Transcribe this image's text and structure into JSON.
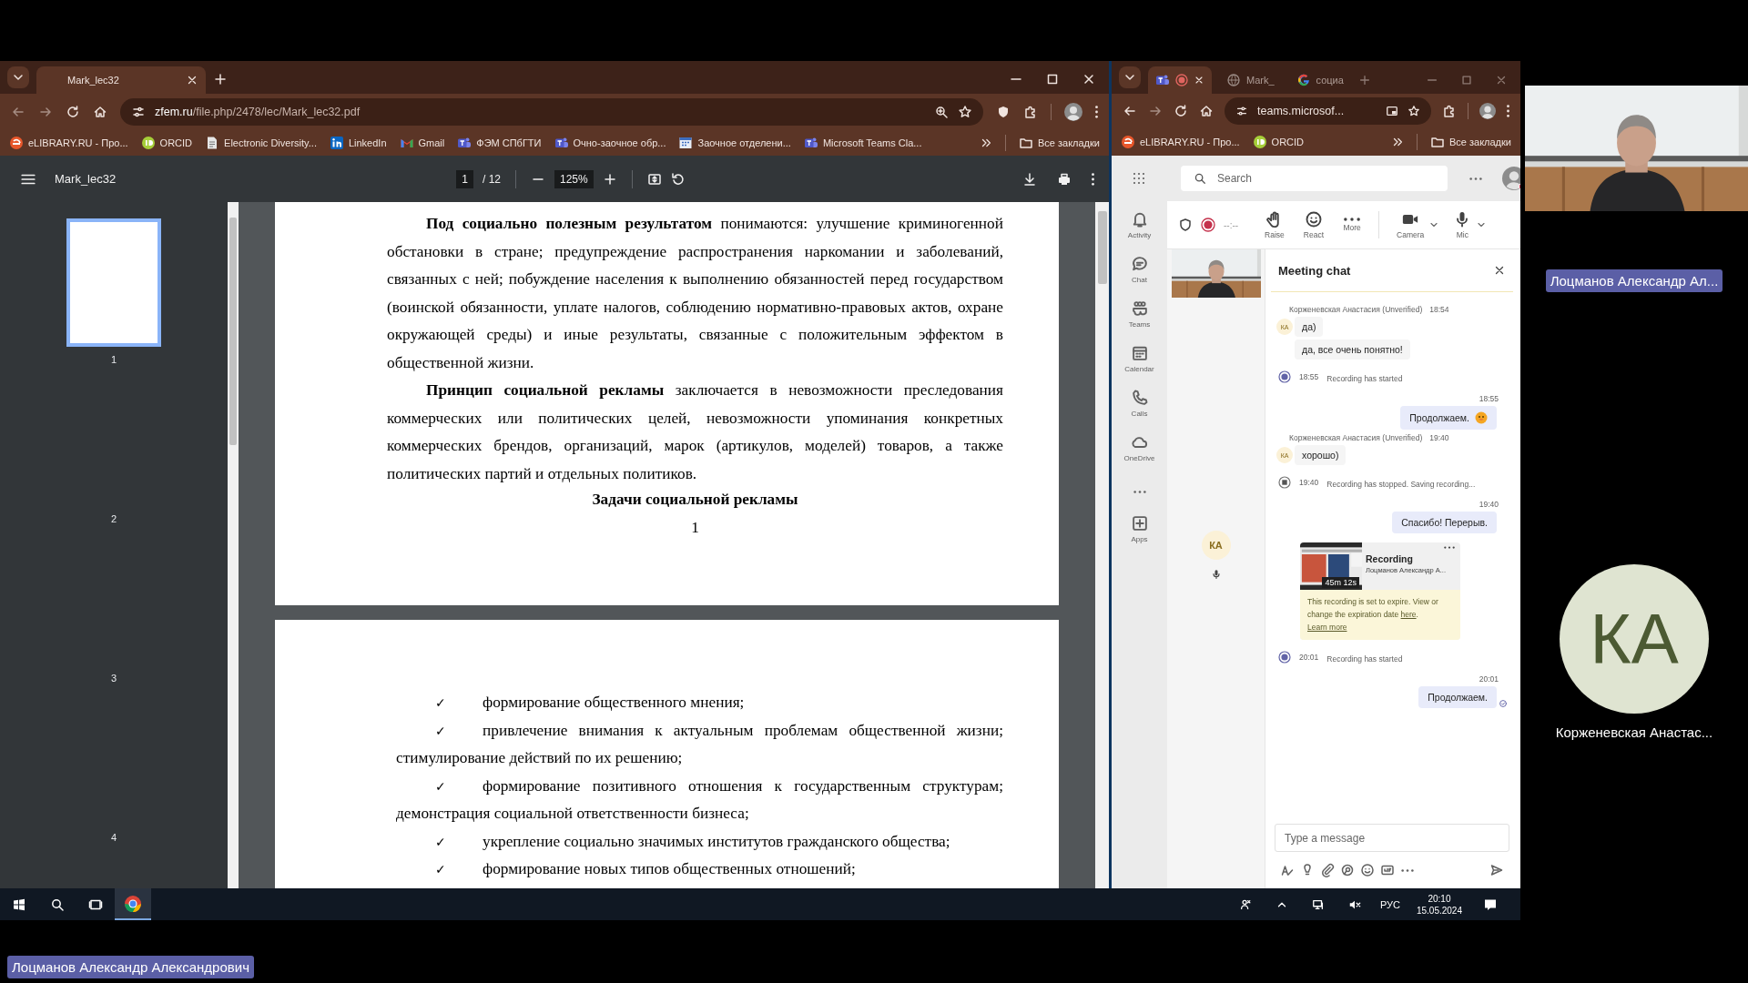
{
  "pdf_browser": {
    "tabs": [
      {
        "label": "Mark_lec32",
        "selected": true
      }
    ],
    "address": {
      "host": "zfem.ru",
      "path": "/file.php/2478/lec/Mark_lec32.pdf"
    },
    "bookmarks": [
      {
        "label": "eLIBRARY.RU - Про...",
        "kind": "elibrary"
      },
      {
        "label": "ORCID",
        "kind": "orcid"
      },
      {
        "label": "Electronic Diversity...",
        "kind": "page"
      },
      {
        "label": "LinkedIn",
        "kind": "linkedin"
      },
      {
        "label": "Gmail",
        "kind": "gmail"
      },
      {
        "label": "ФЭМ СПбГТИ",
        "kind": "teams"
      },
      {
        "label": "Очно-заочное обр...",
        "kind": "teams"
      },
      {
        "label": "Заочное отделени...",
        "kind": "calendar"
      },
      {
        "label": "Microsoft Teams Cla...",
        "kind": "teams"
      }
    ],
    "all_bookmarks": "Все закладки"
  },
  "pdf_viewer": {
    "title": "Mark_lec32",
    "page": "1",
    "page_total": "/ 12",
    "zoom": "125%",
    "thumbnails": [
      {
        "label": "1",
        "selected": true
      },
      {
        "label": "2",
        "selected": false
      },
      {
        "label": "3",
        "selected": false
      },
      {
        "label": "4",
        "selected": false
      }
    ],
    "pages": [
      {
        "blocks": [
          {
            "kind": "paragraph",
            "text": "**Под социально полезным результатом** понимаются: улучшение криминогенной обстановки в стране; предупреждение распространения наркомании и заболеваний, связанных с ней; побуждение населения к выполнению обязанностей перед государством (воинской обязанности, уплате налогов, соблюдению нормативно-правовых актов, охране окружающей среды) и иные результаты, связанные с положительным эффектом в общественной жизни."
          },
          {
            "kind": "paragraph",
            "text": "**Принцип социальной рекламы** заключается в невозможности преследования коммерческих или политических целей, невозможности упоминания конкретных коммерческих брендов, организаций, марок (артикулов, моделей) товаров, а также политических партий и отдельных политиков."
          },
          {
            "kind": "heading",
            "text": "Задачи социальной рекламы"
          },
          {
            "kind": "page_number",
            "text": "1"
          }
        ]
      },
      {
        "blocks": [
          {
            "kind": "check_item",
            "marker": "✓",
            "text": "формирование общественного мнения;"
          },
          {
            "kind": "check_item",
            "marker": "✓",
            "text": "привлечение внимания к актуальным проблемам общественной жизни; стимулирование действий по их решению;"
          },
          {
            "kind": "check_item",
            "marker": "✓",
            "text": "формирование позитивного отношения к государственным структурам; демонстрация социальной ответственности бизнеса;"
          },
          {
            "kind": "check_item",
            "marker": "✓",
            "text": "укрепление социально значимых институтов гражданского общества;"
          },
          {
            "kind": "check_item",
            "marker": "✓",
            "text": "формирование новых типов общественных отношений;"
          }
        ]
      }
    ]
  },
  "teams_browser": {
    "tabs": [
      {
        "kind": "teams",
        "recording": true,
        "selected": true
      },
      {
        "kind": "globe",
        "label": "Mark_",
        "recording": false,
        "selected": false
      },
      {
        "kind": "google",
        "label": "социа",
        "recording": false,
        "selected": false
      }
    ],
    "address": "teams.microsof...",
    "bookmarks": [
      {
        "label": "eLIBRARY.RU - Про...",
        "kind": "elibrary"
      },
      {
        "label": "ORCID",
        "kind": "orcid"
      }
    ],
    "all_bookmarks": "Все закладки"
  },
  "teams": {
    "search": {
      "placeholder": "Search"
    },
    "rail": [
      {
        "kind": "activity",
        "label": "Activity"
      },
      {
        "kind": "chat",
        "label": "Chat"
      },
      {
        "kind": "teams",
        "label": "Teams"
      },
      {
        "kind": "calendar",
        "label": "Calendar"
      },
      {
        "kind": "calls",
        "label": "Calls"
      },
      {
        "kind": "onedrive",
        "label": "OneDrive"
      },
      {
        "kind": "more"
      },
      {
        "kind": "apps",
        "label": "Apps"
      }
    ],
    "meeting_toolbar": {
      "timer": "--:--",
      "actions": [
        {
          "kind": "raise",
          "label": "Raise"
        },
        {
          "kind": "react",
          "label": "React"
        },
        {
          "kind": "more",
          "label": "More"
        },
        {
          "kind": "camera",
          "label": "Camera"
        },
        {
          "kind": "mic",
          "label": "Mic"
        }
      ]
    },
    "participant": {
      "initials": "КА"
    },
    "chat": {
      "title": "Meeting chat",
      "messages": [
        {
          "kind": "incoming",
          "sender": "Корженевская Анастасия (Unverified)",
          "time": "18:54",
          "avatar": "КА",
          "texts": [
            "да)",
            "да, все очень понятно!"
          ]
        },
        {
          "kind": "recording_started",
          "time": "18:55",
          "text": "Recording has started"
        },
        {
          "kind": "outgoing",
          "time": "18:55",
          "text": "Продолжаем.",
          "emoji": true,
          "seen": false
        },
        {
          "kind": "incoming",
          "sender": "Корженевская Анастасия (Unverified)",
          "time": "19:40",
          "avatar": "КА",
          "texts": [
            "хорошо)"
          ]
        },
        {
          "kind": "recording_stopped",
          "time": "19:40",
          "text": "Recording has stopped. Saving recording..."
        },
        {
          "kind": "outgoing",
          "time": "19:40",
          "text": "Спасибо! Перерыв.",
          "emoji": false,
          "seen": false
        },
        {
          "kind": "recording",
          "title": "Recording",
          "owner": "Лоцманов Александр А...",
          "duration": "45m 12s",
          "notice": "This recording is set to expire. View or change the expiration date",
          "notice_link": "here",
          "notice_end": ".",
          "learn_more": "Learn more"
        },
        {
          "kind": "recording_started",
          "time": "20:01",
          "text": "Recording has started"
        },
        {
          "kind": "outgoing",
          "time": "20:01",
          "text": "Продолжаем.",
          "emoji": false,
          "seen": true
        }
      ],
      "composer": {
        "placeholder": "Type a message"
      }
    }
  },
  "taskbar": {
    "language": "РУС",
    "time": "20:10",
    "date": "15.05.2024"
  },
  "stage": {
    "presenter_name": "Лоцманов Александр Ал...",
    "attendee": {
      "initials": "КА",
      "name": "Корженевская Анастас..."
    },
    "sharer_name": "Лоцманов Александр Александрович"
  }
}
